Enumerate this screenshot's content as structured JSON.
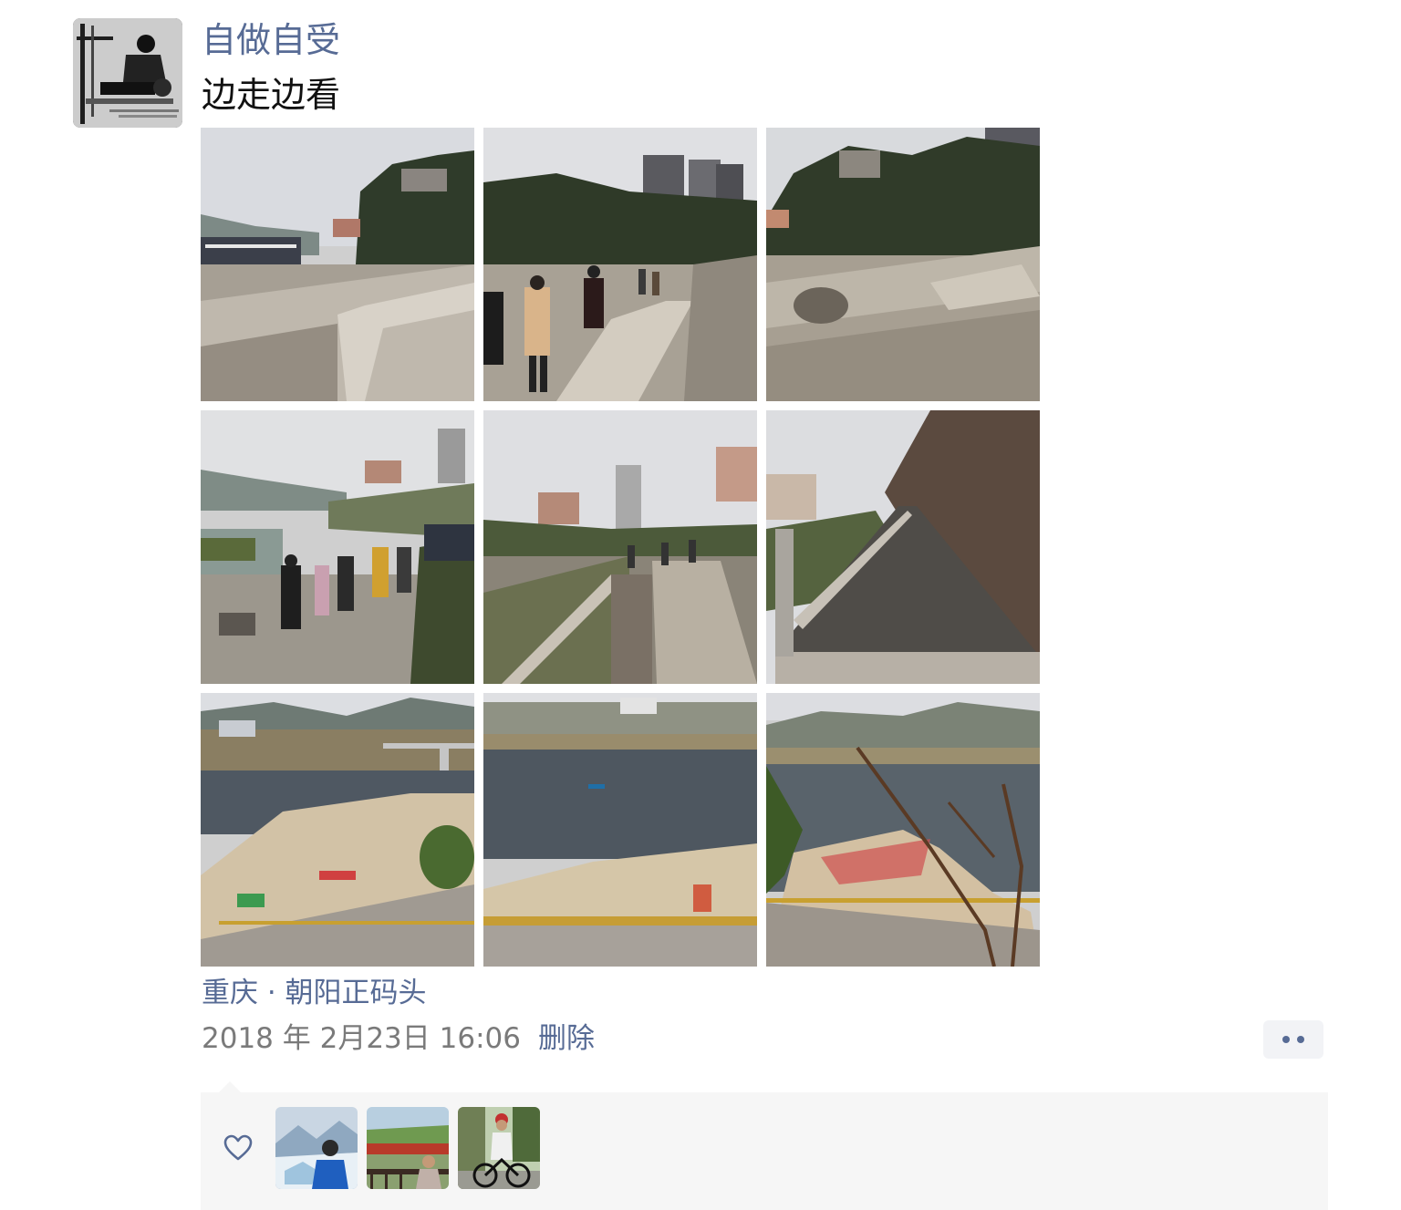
{
  "post": {
    "author": "自做自受",
    "text": "边走边看",
    "location": "重庆 · 朝阳正码头",
    "timestamp": "2018 年 2月23日 16:06",
    "delete_label": "删除",
    "more_icon": "more-dots-icon"
  },
  "photos": [
    {
      "scene": "riverbank-rock-walkway"
    },
    {
      "scene": "people-walking-on-rock-path"
    },
    {
      "scene": "rocky-shore-with-buildings"
    },
    {
      "scene": "group-walking-by-river"
    },
    {
      "scene": "stairs-down-to-riverbank"
    },
    {
      "scene": "long-stone-staircase"
    },
    {
      "scene": "river-beach-with-bridge"
    },
    {
      "scene": "river-beach-with-people"
    },
    {
      "scene": "river-beach-viewed-through-branches"
    }
  ],
  "likes": {
    "icon": "heart-icon",
    "count": 3
  },
  "colors": {
    "link": "#576b95",
    "text": "#111111",
    "meta": "#7a7a7a",
    "likes_bg": "#f6f6f6"
  }
}
